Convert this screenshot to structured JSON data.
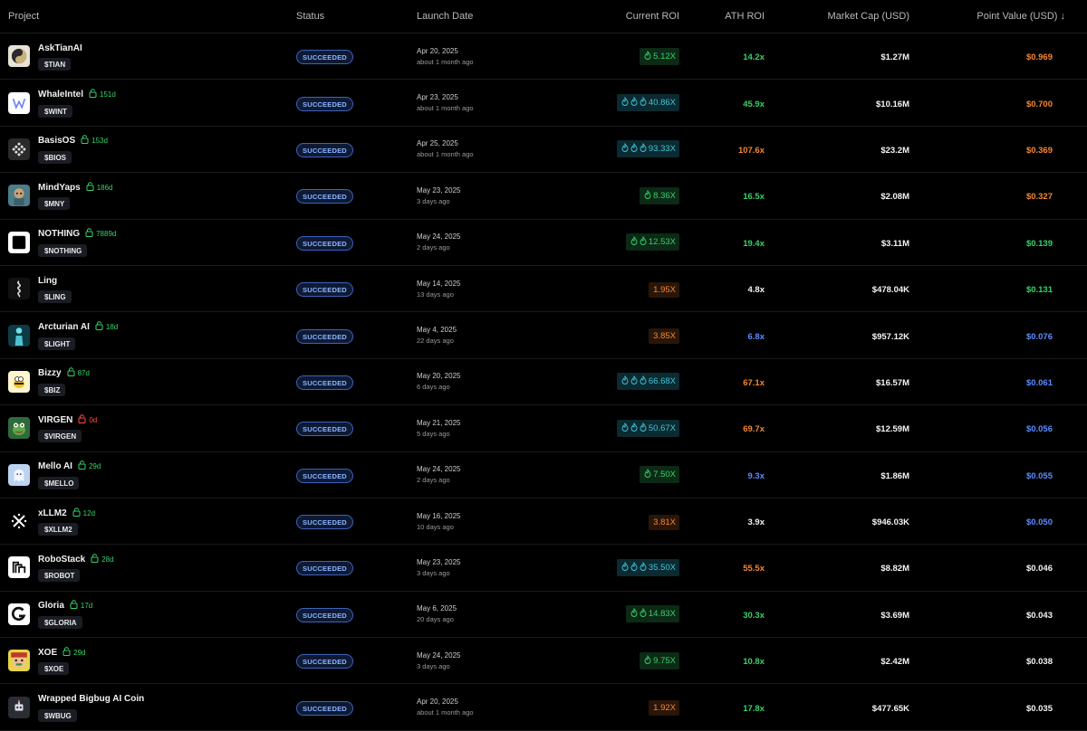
{
  "header": {
    "project": "Project",
    "status": "Status",
    "launch_date": "Launch Date",
    "current_roi": "Current ROI",
    "ath_roi": "ATH ROI",
    "market_cap": "Market Cap (USD)",
    "point_value": "Point Value (USD) ↓"
  },
  "colors": {
    "green": "#35d36a",
    "cyan": "#3fc7d9",
    "orange": "#f5872f",
    "blue": "#5b8cff",
    "white": "#f4f4f4",
    "lock_green": "#35d36a",
    "lock_red": "#ff4d4d"
  },
  "rows": [
    {
      "name": "AskTianAI",
      "ticker": "$TIAN",
      "lock": "",
      "lock_color": "",
      "status": "SUCCEEDED",
      "date": "Apr 20, 2025",
      "ago": "about 1 month ago",
      "roi": "5.12X",
      "roi_style": "green",
      "flames": 1,
      "ath": "14.2x",
      "ath_color": "green",
      "mcap": "$1.27M",
      "point": "$0.969",
      "point_color": "orange",
      "avatar_icon": "yin-yang-icon"
    },
    {
      "name": "WhaleIntel",
      "ticker": "$WINT",
      "lock": "151d",
      "lock_color": "green",
      "status": "SUCCEEDED",
      "date": "Apr 23, 2025",
      "ago": "about 1 month ago",
      "roi": "40.86X",
      "roi_style": "cyan",
      "flames": 3,
      "ath": "45.9x",
      "ath_color": "green",
      "mcap": "$10.16M",
      "point": "$0.700",
      "point_color": "orange",
      "avatar_icon": "whale-logo-icon"
    },
    {
      "name": "BasisOS",
      "ticker": "$BIOS",
      "lock": "153d",
      "lock_color": "green",
      "status": "SUCCEEDED",
      "date": "Apr 25, 2025",
      "ago": "about 1 month ago",
      "roi": "93.33X",
      "roi_style": "cyan",
      "flames": 3,
      "ath": "107.6x",
      "ath_color": "orange",
      "mcap": "$23.2M",
      "point": "$0.369",
      "point_color": "orange",
      "avatar_icon": "diamond-grid-icon"
    },
    {
      "name": "MindYaps",
      "ticker": "$MNY",
      "lock": "186d",
      "lock_color": "green",
      "status": "SUCCEEDED",
      "date": "May 23, 2025",
      "ago": "3 days ago",
      "roi": "8.36X",
      "roi_style": "green",
      "flames": 1,
      "ath": "16.5x",
      "ath_color": "green",
      "mcap": "$2.08M",
      "point": "$0.327",
      "point_color": "orange",
      "avatar_icon": "character-icon"
    },
    {
      "name": "NOTHING",
      "ticker": "$NOTHING",
      "lock": "7889d",
      "lock_color": "green",
      "status": "SUCCEEDED",
      "date": "May 24, 2025",
      "ago": "2 days ago",
      "roi": "12.53X",
      "roi_style": "green",
      "flames": 2,
      "ath": "19.4x",
      "ath_color": "green",
      "mcap": "$3.11M",
      "point": "$0.139",
      "point_color": "green",
      "avatar_icon": "black-square-icon"
    },
    {
      "name": "Ling",
      "ticker": "$LING",
      "lock": "",
      "lock_color": "",
      "status": "SUCCEEDED",
      "date": "May 14, 2025",
      "ago": "13 days ago",
      "roi": "1.95X",
      "roi_style": "orange",
      "flames": 0,
      "ath": "4.8x",
      "ath_color": "white",
      "mcap": "$478.04K",
      "point": "$0.131",
      "point_color": "green",
      "avatar_icon": "glyph-icon"
    },
    {
      "name": "Arcturian AI",
      "ticker": "$LIGHT",
      "lock": "18d",
      "lock_color": "green",
      "status": "SUCCEEDED",
      "date": "May 4, 2025",
      "ago": "22 days ago",
      "roi": "3.85X",
      "roi_style": "orange",
      "flames": 0,
      "ath": "6.8x",
      "ath_color": "blue",
      "mcap": "$957.12K",
      "point": "$0.076",
      "point_color": "blue",
      "avatar_icon": "figure-icon"
    },
    {
      "name": "Bizzy",
      "ticker": "$BIZ",
      "lock": "87d",
      "lock_color": "green",
      "status": "SUCCEEDED",
      "date": "May 20, 2025",
      "ago": "6 days ago",
      "roi": "66.68X",
      "roi_style": "cyan",
      "flames": 3,
      "ath": "67.1x",
      "ath_color": "orange",
      "mcap": "$16.57M",
      "point": "$0.061",
      "point_color": "blue",
      "avatar_icon": "bee-icon"
    },
    {
      "name": "VIRGEN",
      "ticker": "$VIRGEN",
      "lock": "0d",
      "lock_color": "red",
      "status": "SUCCEEDED",
      "date": "May 21, 2025",
      "ago": "5 days ago",
      "roi": "50.67X",
      "roi_style": "cyan",
      "flames": 3,
      "ath": "69.7x",
      "ath_color": "orange",
      "mcap": "$12.59M",
      "point": "$0.056",
      "point_color": "blue",
      "avatar_icon": "frog-icon"
    },
    {
      "name": "Mello AI",
      "ticker": "$MELLO",
      "lock": "29d",
      "lock_color": "green",
      "status": "SUCCEEDED",
      "date": "May 24, 2025",
      "ago": "2 days ago",
      "roi": "7.50X",
      "roi_style": "green",
      "flames": 1,
      "ath": "9.3x",
      "ath_color": "blue",
      "mcap": "$1.86M",
      "point": "$0.055",
      "point_color": "blue",
      "avatar_icon": "ghost-icon"
    },
    {
      "name": "xLLM2",
      "ticker": "$XLLM2",
      "lock": "12d",
      "lock_color": "green",
      "status": "SUCCEEDED",
      "date": "May 16, 2025",
      "ago": "10 days ago",
      "roi": "3.81X",
      "roi_style": "orange",
      "flames": 0,
      "ath": "3.9x",
      "ath_color": "white",
      "mcap": "$946.03K",
      "point": "$0.050",
      "point_color": "blue",
      "avatar_icon": "cross-icon"
    },
    {
      "name": "RoboStack",
      "ticker": "$ROBOT",
      "lock": "28d",
      "lock_color": "green",
      "status": "SUCCEEDED",
      "date": "May 23, 2025",
      "ago": "3 days ago",
      "roi": "35.50X",
      "roi_style": "cyan",
      "flames": 3,
      "ath": "55.5x",
      "ath_color": "orange",
      "mcap": "$8.82M",
      "point": "$0.046",
      "point_color": "white",
      "avatar_icon": "stack-logo-icon"
    },
    {
      "name": "Gloria",
      "ticker": "$GLORIA",
      "lock": "17d",
      "lock_color": "green",
      "status": "SUCCEEDED",
      "date": "May 6, 2025",
      "ago": "20 days ago",
      "roi": "14.83X",
      "roi_style": "green",
      "flames": 2,
      "ath": "30.3x",
      "ath_color": "green",
      "mcap": "$3.69M",
      "point": "$0.043",
      "point_color": "white",
      "avatar_icon": "g-logo-icon"
    },
    {
      "name": "XOE",
      "ticker": "$XOE",
      "lock": "29d",
      "lock_color": "green",
      "status": "SUCCEEDED",
      "date": "May 24, 2025",
      "ago": "3 days ago",
      "roi": "9.75X",
      "roi_style": "green",
      "flames": 1,
      "ath": "10.8x",
      "ath_color": "green",
      "mcap": "$2.42M",
      "point": "$0.038",
      "point_color": "white",
      "avatar_icon": "pixel-face-icon"
    },
    {
      "name": "Wrapped Bigbug AI Coin",
      "ticker": "$WBUG",
      "lock": "",
      "lock_color": "",
      "status": "SUCCEEDED",
      "date": "Apr 20, 2025",
      "ago": "about 1 month ago",
      "roi": "1.92X",
      "roi_style": "orange",
      "flames": 0,
      "ath": "17.8x",
      "ath_color": "green",
      "mcap": "$477.65K",
      "point": "$0.035",
      "point_color": "white",
      "avatar_icon": "robot-icon"
    }
  ]
}
